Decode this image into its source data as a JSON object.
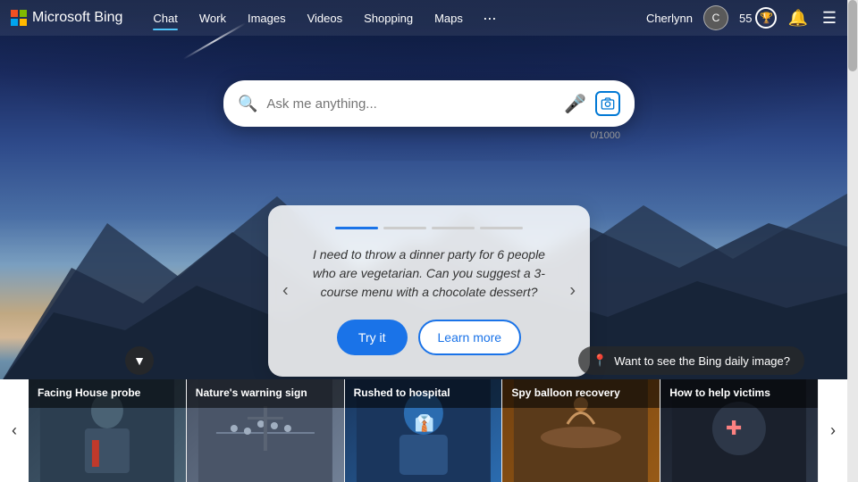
{
  "app": {
    "title": "Microsoft Bing"
  },
  "header": {
    "logo_text": "Microsoft Bing",
    "nav_items": [
      {
        "label": "Chat",
        "active": false
      },
      {
        "label": "Work",
        "active": false
      },
      {
        "label": "Images",
        "active": false
      },
      {
        "label": "Videos",
        "active": false
      },
      {
        "label": "Shopping",
        "active": false
      },
      {
        "label": "Maps",
        "active": false
      },
      {
        "label": "···",
        "active": false
      }
    ],
    "user_name": "Cherlynn",
    "user_initials": "C",
    "score": "55",
    "score_icon": "🏆",
    "bell_icon": "🔔",
    "menu_icon": "☰"
  },
  "search": {
    "placeholder": "Ask me anything...",
    "char_count": "0/1000",
    "mic_icon": "🎤",
    "camera_icon": "⊡"
  },
  "suggestion_card": {
    "progress": [
      {
        "active": true
      },
      {
        "active": false
      },
      {
        "active": false
      },
      {
        "active": false
      }
    ],
    "text": "I need to throw a dinner party for 6 people who are vegetarian. Can you suggest a 3-course menu with a chocolate dessert?",
    "try_label": "Try it",
    "learn_label": "Learn more",
    "prev_icon": "‹",
    "next_icon": "›"
  },
  "collapse": {
    "icon": "▼"
  },
  "daily_image": {
    "icon": "📍",
    "label": "Want to see the Bing daily image?"
  },
  "news_cards": [
    {
      "title": "Facing House probe",
      "img_class": "news-img-1"
    },
    {
      "title": "Nature's warning sign",
      "img_class": "news-img-2"
    },
    {
      "title": "Rushed to hospital",
      "img_class": "news-img-3"
    },
    {
      "title": "Spy balloon recovery",
      "img_class": "news-img-4"
    },
    {
      "title": "How to help victims",
      "img_class": "news-img-5"
    }
  ],
  "nav_prev_icon": "‹",
  "nav_next_icon": "›"
}
